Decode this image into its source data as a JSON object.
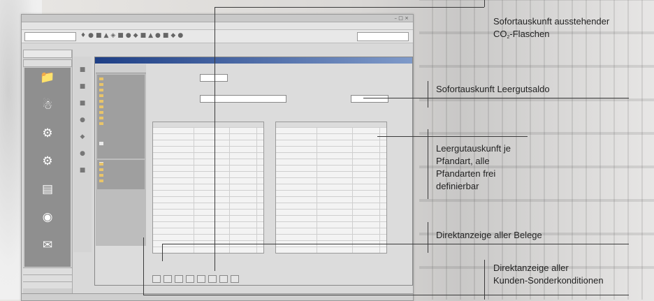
{
  "app": {
    "title": "",
    "menu": "",
    "toolbar": {
      "combo_value": "",
      "user_field": ""
    },
    "statusbar": {
      "left": "",
      "middle": ""
    }
  },
  "nav": {
    "header": "",
    "subheader": "",
    "items": [
      {
        "label": "",
        "icon": "folder-icon"
      },
      {
        "label": "",
        "icon": "person-icon"
      },
      {
        "label": "",
        "icon": "gear-icon"
      },
      {
        "label": "",
        "icon": "gear-icon"
      },
      {
        "label": "",
        "icon": "document-icon"
      },
      {
        "label": "",
        "icon": "globe-icon"
      },
      {
        "label": "",
        "icon": "mail-icon"
      },
      {
        "label": "",
        "icon": "document-icon"
      }
    ],
    "footer": [
      "",
      "",
      ""
    ]
  },
  "doc": {
    "title": "",
    "side_header": "",
    "side_items": [
      "",
      "",
      "",
      "",
      "",
      "",
      "",
      "",
      "",
      "",
      ""
    ],
    "side_extra": [
      "",
      ""
    ],
    "side_bottom": [
      "",
      "",
      "",
      ""
    ],
    "form": {
      "nr_label": "",
      "nr_value": "",
      "name_label": "",
      "name_value": "",
      "saldo_label": "",
      "saldo_value": ""
    },
    "grid_headers": [
      "",
      "",
      ""
    ],
    "grid_left_rows": [
      [
        "",
        "",
        ""
      ],
      [
        "",
        "",
        ""
      ],
      [
        "",
        "",
        ""
      ],
      [
        "",
        "",
        ""
      ],
      [
        "",
        "",
        ""
      ],
      [
        "",
        "",
        ""
      ],
      [
        "",
        "",
        ""
      ],
      [
        "",
        "",
        ""
      ],
      [
        "",
        "",
        ""
      ],
      [
        "",
        "",
        ""
      ],
      [
        "",
        "",
        ""
      ],
      [
        "",
        "",
        ""
      ],
      [
        "",
        "",
        ""
      ],
      [
        "",
        "",
        ""
      ],
      [
        "",
        "",
        ""
      ],
      [
        "",
        "",
        ""
      ],
      [
        "",
        "",
        ""
      ],
      [
        "",
        "",
        ""
      ],
      [
        "",
        "",
        ""
      ],
      [
        "",
        "",
        ""
      ]
    ],
    "grid_right_rows": [
      [
        "",
        "",
        ""
      ],
      [
        "",
        "",
        ""
      ],
      [
        "",
        "",
        ""
      ],
      [
        "",
        "",
        ""
      ],
      [
        "",
        "",
        ""
      ],
      [
        "",
        "",
        ""
      ],
      [
        "",
        "",
        ""
      ],
      [
        "",
        "",
        ""
      ],
      [
        "",
        "",
        ""
      ],
      [
        "",
        "",
        ""
      ],
      [
        "",
        "",
        ""
      ],
      [
        "",
        "",
        ""
      ],
      [
        "",
        "",
        ""
      ],
      [
        "",
        "",
        ""
      ],
      [
        "",
        "",
        ""
      ],
      [
        "",
        "",
        ""
      ],
      [
        "",
        "",
        ""
      ],
      [
        "",
        "",
        ""
      ],
      [
        "",
        "",
        ""
      ],
      [
        "",
        "",
        ""
      ]
    ],
    "buttons": [
      "",
      "",
      "",
      "",
      "",
      "",
      "",
      ""
    ]
  },
  "callouts": {
    "c1_line1": "Sofortauskunft ausstehender",
    "c1_line2_pre": "CO",
    "c1_sub": "2",
    "c1_line2_post": "-Flaschen",
    "c2": "Sofortauskunft Leergutsaldo",
    "c3_lines": [
      "Leergutauskunft je",
      "Pfandart, alle",
      "Pfandarten frei",
      "definierbar"
    ],
    "c4": "Direktanzeige aller Belege",
    "c5_lines": [
      "Direktanzeige aller",
      "Kunden-Sonderkonditionen"
    ]
  }
}
